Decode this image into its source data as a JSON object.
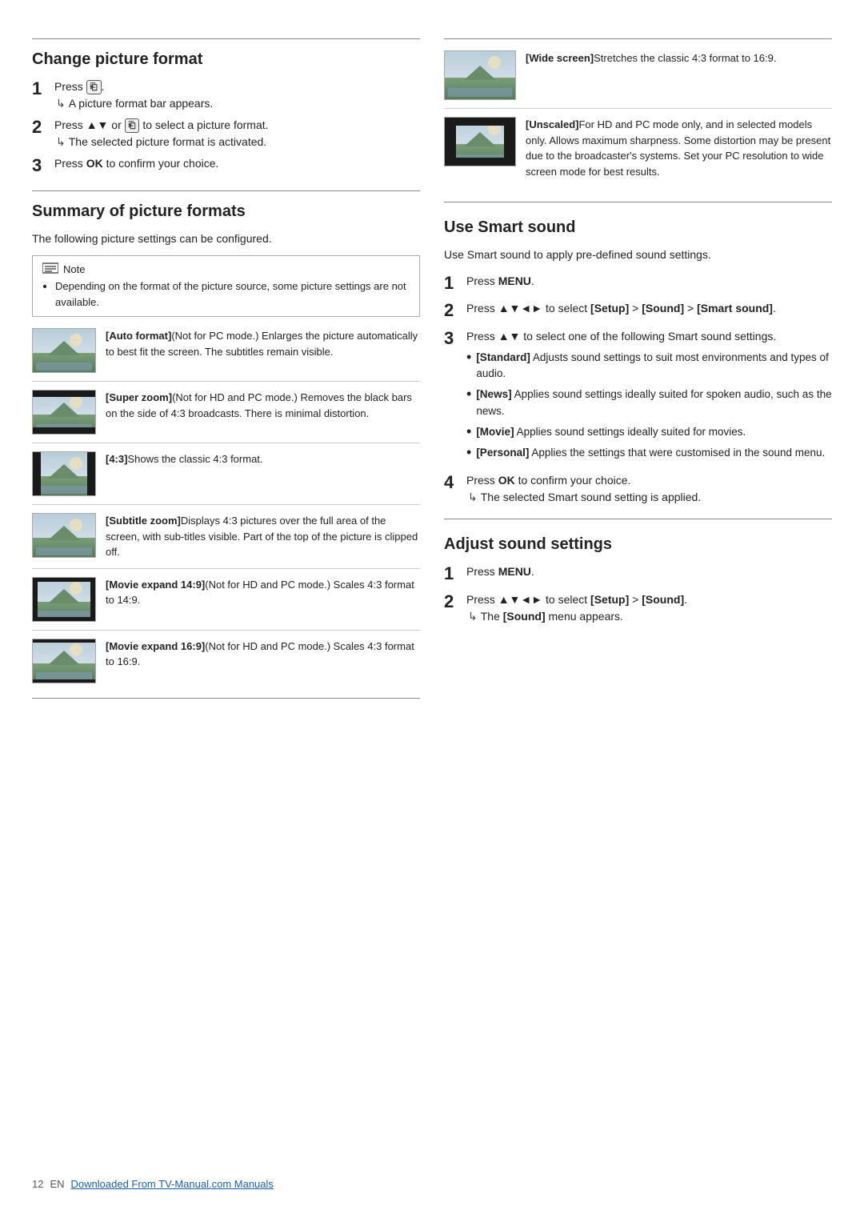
{
  "page": {
    "pageNum": "12",
    "lang": "EN"
  },
  "footer": {
    "linkText": "Downloaded From TV-Manual.com Manuals"
  },
  "left": {
    "changePicture": {
      "title": "Change picture format",
      "steps": [
        {
          "num": "1",
          "text": "Press",
          "icon": "format-button",
          "subtext": "A picture format bar appears."
        },
        {
          "num": "2",
          "text": "Press ▲▼ or",
          "icon": "format-button2",
          "text2": "to select a picture format.",
          "subtext": "The selected picture format is activated."
        },
        {
          "num": "3",
          "text": "Press OK to confirm your choice."
        }
      ]
    },
    "summaryFormats": {
      "title": "Summary of picture formats",
      "intro": "The following picture settings can be configured.",
      "note": {
        "label": "Note",
        "text": "Depending on the format of the picture source, some picture settings are not available."
      },
      "formats": [
        {
          "id": "auto-format",
          "boldLabel": "[Auto format]",
          "desc": "(Not for PC mode.) Enlarges the picture automatically to best fit the screen. The subtitles remain visible."
        },
        {
          "id": "super-zoom",
          "boldLabel": "[Super zoom]",
          "desc": "(Not for HD and PC mode.) Removes the black bars on the side of 4:3 broadcasts. There is minimal distortion."
        },
        {
          "id": "4-3",
          "boldLabel": "[4:3]",
          "desc": "Shows the classic 4:3 format."
        },
        {
          "id": "subtitle-zoom",
          "boldLabel": "[Subtitle zoom]",
          "desc": "Displays 4:3 pictures over the full area of the screen, with sub-titles visible. Part of the top of the picture is clipped off."
        },
        {
          "id": "movie-expand-14-9",
          "boldLabel": "[Movie expand 14:9]",
          "desc": "(Not for HD and PC mode.) Scales 4:3 format to 14:9."
        },
        {
          "id": "movie-expand-16-9",
          "boldLabel": "[Movie expand 16:9]",
          "desc": "(Not for HD and PC mode.) Scales 4:3 format to 16:9."
        }
      ]
    }
  },
  "right": {
    "formats": [
      {
        "id": "wide-screen",
        "boldLabel": "[Wide screen]",
        "desc": "Stretches the classic 4:3 format to 16:9."
      },
      {
        "id": "unscaled",
        "boldLabel": "[Unscaled]",
        "desc": "For HD and PC mode only, and in selected models only. Allows maximum sharpness. Some distortion may be present due to the broadcaster's systems. Set your PC resolution to wide screen mode for best results."
      }
    ],
    "useSmartSound": {
      "title": "Use Smart sound",
      "intro": "Use Smart sound to apply pre-defined sound settings.",
      "steps": [
        {
          "num": "1",
          "text": "Press MENU."
        },
        {
          "num": "2",
          "text": "Press ▲▼◄► to select [Setup] > [Sound] > [Smart sound]."
        },
        {
          "num": "3",
          "text": "Press ▲▼ to select one of the following Smart sound settings.",
          "bullets": [
            {
              "label": "[Standard]",
              "desc": "Adjusts sound settings to suit most environments and types of audio."
            },
            {
              "label": "[News]",
              "desc": "Applies sound settings ideally suited for spoken audio, such as the news."
            },
            {
              "label": "[Movie]",
              "desc": "Applies sound settings ideally suited for movies."
            },
            {
              "label": "[Personal]",
              "desc": "Applies the settings that were customised in the sound menu."
            }
          ]
        },
        {
          "num": "4",
          "text": "Press OK to confirm your choice.",
          "subtext": "The selected Smart sound setting is applied."
        }
      ]
    },
    "adjustSound": {
      "title": "Adjust sound settings",
      "steps": [
        {
          "num": "1",
          "text": "Press MENU."
        },
        {
          "num": "2",
          "text": "Press ▲▼◄► to select [Setup] > [Sound].",
          "subtext": "The [Sound] menu appears."
        }
      ]
    }
  }
}
